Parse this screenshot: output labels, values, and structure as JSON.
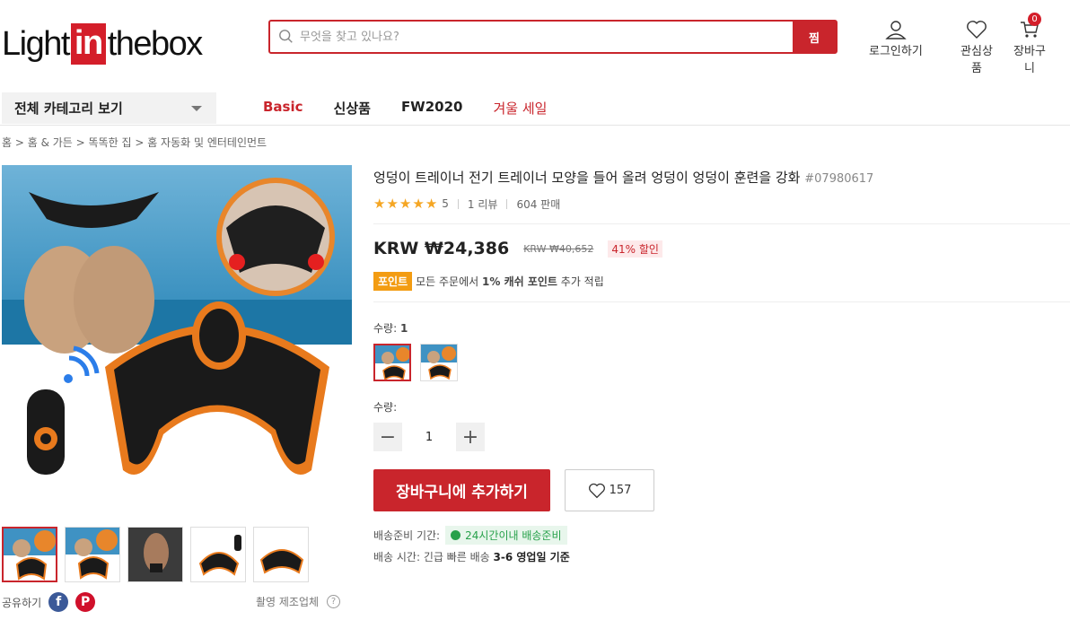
{
  "logo": {
    "pre": "Light",
    "mid": "in",
    "post": "thebox"
  },
  "search": {
    "placeholder": "무엇을 찾고 있나요?",
    "button": "찜"
  },
  "header": {
    "login": "로그인하기",
    "wishlist": "관심상품",
    "cart": "장바구니",
    "cart_count": "0"
  },
  "nav": {
    "all_categories": "전체 카테고리 보기",
    "items": [
      "Basic",
      "신상품",
      "FW2020",
      "겨울 세일"
    ]
  },
  "breadcrumb": [
    "홈",
    "홈 & 가든",
    "똑똑한 집",
    "홈 자동화 및 엔터테인먼트"
  ],
  "product": {
    "title": "엉덩이 트레이너 전기 트레이너 모양을 들어 올려 엉덩이 엉덩이 훈련을 강화",
    "sku": "#07980617",
    "rating_value": "5",
    "reviews": "1 리뷰",
    "sales": "604 판매",
    "price": "KRW ₩24,386",
    "old_price": "KRW ₩40,652",
    "discount": "41% 할인",
    "points_tag": "포인트",
    "points_text_a": "모든 주문에서",
    "points_text_b": "1% 캐쉬 포인트",
    "points_text_c": "추가 적립",
    "variant_label": "수량:",
    "variant_value": "1",
    "qty_label": "수량:",
    "qty_value": "1",
    "add_to_cart": "장바구니에 추가하기",
    "wish_count": "157",
    "ship_prep_label": "배송준비 기간:",
    "ship_prep_badge": "24시간이내 배송준비",
    "ship_time_label": "배송 시간: 긴급 빠른 배송",
    "ship_time_value": "3-6 영업일 기준"
  },
  "share": {
    "label": "공유하기",
    "report": "촬영 제조업체"
  },
  "colors": {
    "accent": "#c9252c",
    "star": "#f5a623",
    "green": "#27a14a",
    "orange": "#f39c12"
  }
}
